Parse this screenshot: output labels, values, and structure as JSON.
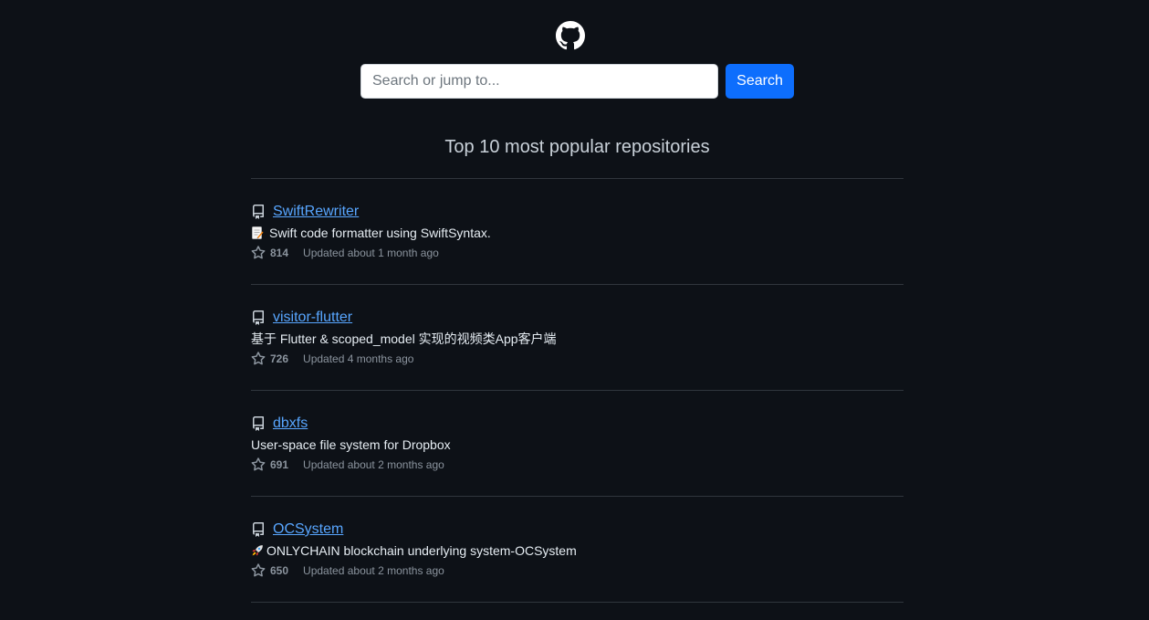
{
  "search": {
    "placeholder": "Search or jump to...",
    "button_label": "Search"
  },
  "heading": "Top 10 most popular repositories",
  "repos": [
    {
      "name": "SwiftRewriter",
      "emoji": "memo-emoji",
      "description": "Swift code formatter using SwiftSyntax.",
      "stars": "814",
      "updated": "Updated about 1 month ago"
    },
    {
      "name": "visitor-flutter",
      "emoji": "",
      "description": "基于 Flutter & scoped_model 实现的视频类App客户端",
      "stars": "726",
      "updated": "Updated 4 months ago"
    },
    {
      "name": "dbxfs",
      "emoji": "",
      "description": "User-space file system for Dropbox",
      "stars": "691",
      "updated": "Updated about 2 months ago"
    },
    {
      "name": "OCSystem",
      "emoji": "rocket-emoji",
      "description": "ONLYCHAIN blockchain underlying system-OCSystem",
      "stars": "650",
      "updated": "Updated about 2 months ago"
    }
  ]
}
